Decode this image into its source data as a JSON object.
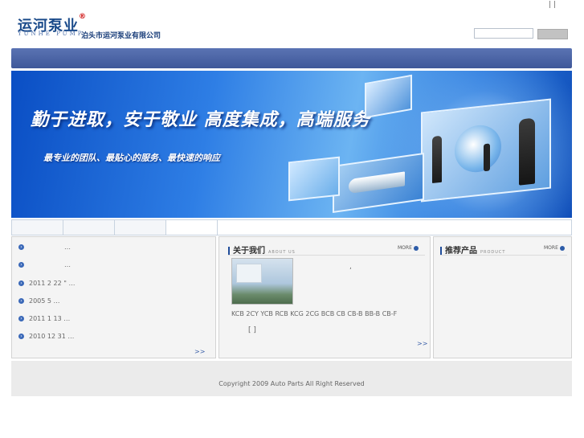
{
  "brand": {
    "logo_cn": "运河泵业",
    "registered": "®",
    "logo_en": "YUNHE PUMP",
    "company": "泊头市运河泵业有限公司"
  },
  "top_links": "|   |",
  "search": {
    "value": "",
    "button_label": ""
  },
  "banner": {
    "slogan_main": "勤于进取，安于敬业  高度集成，高端服务",
    "slogan_sub": "最专业的团队、最贴心的服务、最快速的响应"
  },
  "news": {
    "items": [
      {
        "text": "…"
      },
      {
        "text": "…"
      },
      {
        "text": "2011 2 22 \"      …"
      },
      {
        "text": "2005 5          …"
      },
      {
        "text": "2011 1 13         …"
      },
      {
        "text": "2010 12 31         …"
      }
    ],
    "more_label": ">>"
  },
  "about": {
    "title": "关于我们",
    "subtitle": "ABOUT US",
    "more_label": "MORE",
    "comma": ",",
    "products_text": "KCB 2CY YCB RCB KCG 2CG BCB CB CB-B BB-B CB-F",
    "bracket_text": "[ ]",
    "more_arrows": ">>"
  },
  "recommended": {
    "title": "推荐产品",
    "subtitle": "PRODUCT",
    "more_label": "MORE"
  },
  "footer": {
    "copyright": "Copyright 2009 Auto Parts All Right Reserved"
  },
  "colors": {
    "nav": "#4a63a5",
    "banner_blue": "#1e6ad8",
    "accent": "#1f4c9a"
  }
}
